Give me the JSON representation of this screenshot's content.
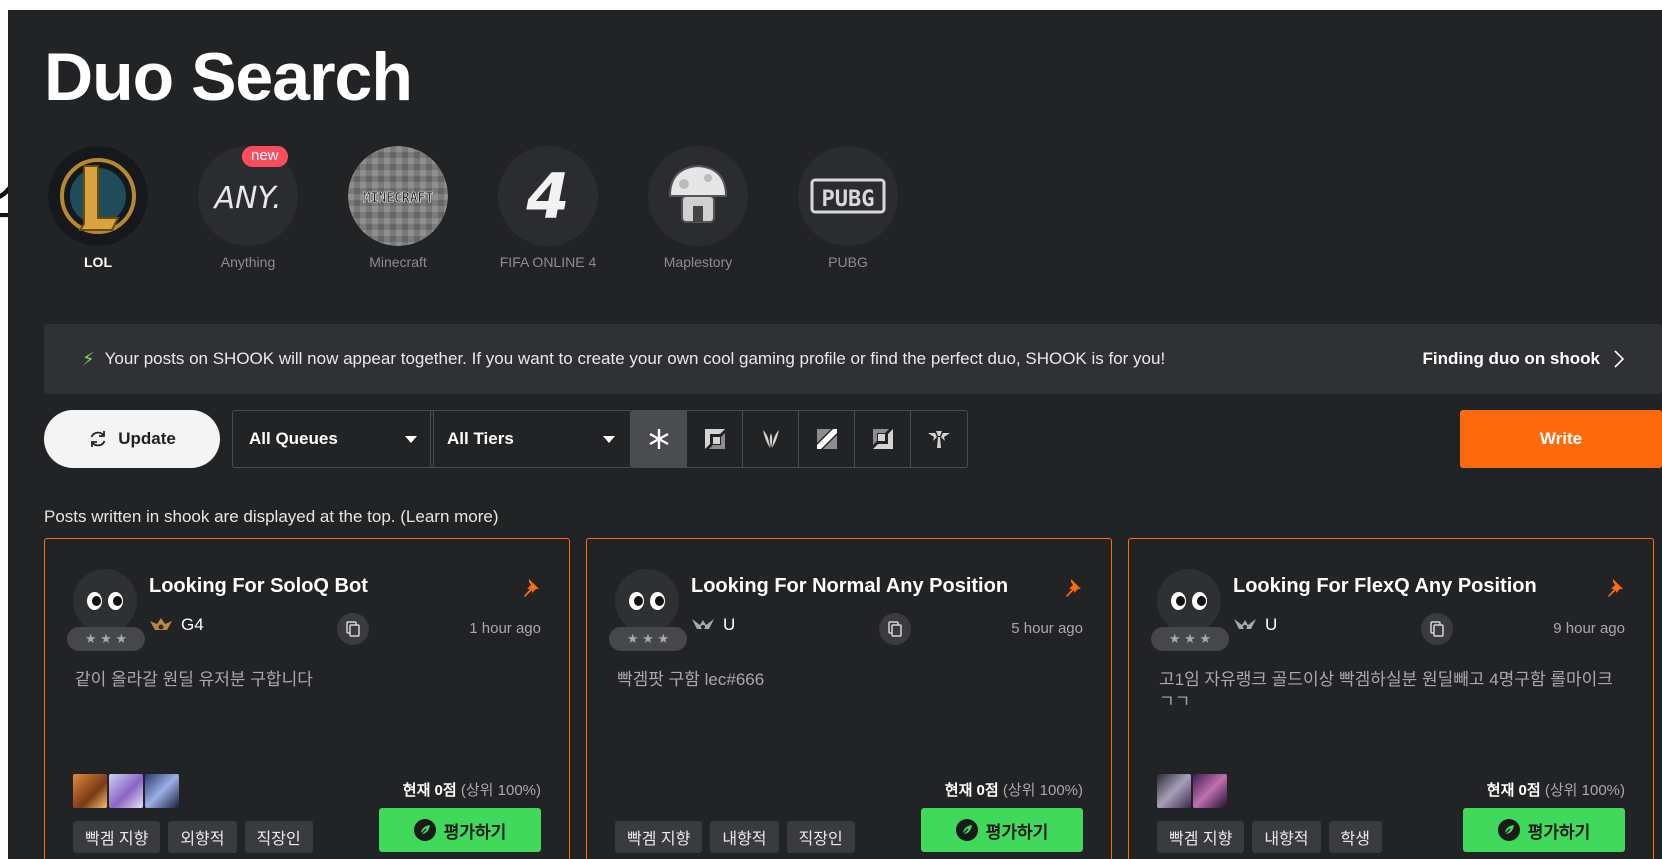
{
  "page": {
    "title": "Duo Search",
    "cut_char": "스"
  },
  "games": [
    {
      "name": "LOL",
      "icon": "lol-icon",
      "active": true
    },
    {
      "name": "Anything",
      "icon": "anything-icon",
      "badge": "new"
    },
    {
      "name": "Minecraft",
      "icon": "minecraft-icon",
      "logo_text": "MINECRAFT"
    },
    {
      "name": "FIFA ONLINE 4",
      "icon": "fifa-icon",
      "logo_text": "4"
    },
    {
      "name": "Maplestory",
      "icon": "maplestory-icon"
    },
    {
      "name": "PUBG",
      "icon": "pubg-icon",
      "logo_text": "PUBG"
    }
  ],
  "notice": {
    "text": "Your posts on SHOOK will now appear together. If you want to create your own cool gaming profile or find the perfect duo, SHOOK is for you!",
    "link": "Finding duo on shook"
  },
  "controls": {
    "update": "Update",
    "queue": "All Queues",
    "tier": "All Tiers",
    "positions": [
      "all-positions-icon",
      "top-icon",
      "jungle-icon",
      "mid-icon",
      "bottom-icon",
      "support-icon"
    ],
    "write": "Write"
  },
  "hint": "Posts written in shook are displayed at the top. (Learn more)",
  "colors": {
    "accent": "#ff6a0f",
    "rate_green": "#41d95b",
    "panel_bg": "#222325",
    "new_badge": "#ff4d5e"
  },
  "posts": [
    {
      "title": "Looking For SoloQ Bot",
      "tier": "G4",
      "tier_icon": "gold-emblem-icon",
      "time": "1 hour ago",
      "body": "같이 올라갈 원딜 유저분 구합니다",
      "champions": [
        "champion-portrait-1",
        "champion-portrait-2",
        "champion-portrait-3"
      ],
      "score_label": "현재 0점",
      "score_rank": "(상위 100%)",
      "tags": [
        "빡겜 지향",
        "외향적",
        "직장인"
      ],
      "rate_label": "평가하기"
    },
    {
      "title": "Looking For Normal Any Position",
      "tier": "U",
      "tier_icon": "unranked-emblem-icon",
      "time": "5 hour ago",
      "body": "빡겜팟 구함 lec#666",
      "champions": [],
      "score_label": "현재 0점",
      "score_rank": "(상위 100%)",
      "tags": [
        "빡겜 지향",
        "내향적",
        "직장인"
      ],
      "rate_label": "평가하기"
    },
    {
      "title": "Looking For FlexQ Any Position",
      "tier": "U",
      "tier_icon": "unranked-emblem-icon",
      "time": "9 hour ago",
      "body": "고1임 자유랭크 골드이상 빡겜하실분 원딜빼고 4명구함 롤마이크 ㄱㄱ",
      "champions": [
        "champion-portrait-4",
        "champion-portrait-5"
      ],
      "score_label": "현재 0점",
      "score_rank": "(상위 100%)",
      "tags": [
        "빡겜 지향",
        "내향적",
        "학생"
      ],
      "rate_label": "평가하기"
    }
  ]
}
